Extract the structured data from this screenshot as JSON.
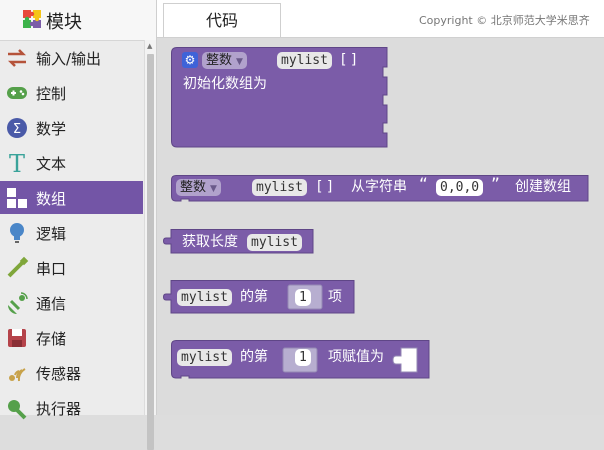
{
  "sidebar": {
    "title": "模块",
    "items": [
      {
        "label": "输入/输出",
        "icon": "arrows-icon"
      },
      {
        "label": "控制",
        "icon": "gamepad-icon"
      },
      {
        "label": "数学",
        "icon": "math-icon"
      },
      {
        "label": "文本",
        "icon": "text-icon"
      },
      {
        "label": "数组",
        "icon": "array-icon",
        "selected": true
      },
      {
        "label": "逻辑",
        "icon": "lightbulb-icon"
      },
      {
        "label": "串口",
        "icon": "serial-icon"
      },
      {
        "label": "通信",
        "icon": "satellite-icon"
      },
      {
        "label": "存储",
        "icon": "storage-icon"
      },
      {
        "label": "传感器",
        "icon": "sensor-icon"
      },
      {
        "label": "执行器",
        "icon": "actuator-icon"
      }
    ]
  },
  "tabs": {
    "code": "代码"
  },
  "copyright": "Copyright © 北京师范大学米思齐",
  "blocks": {
    "b1": {
      "type_label": "整数",
      "var": "mylist",
      "brackets": "[ ]",
      "text": "初始化数组为"
    },
    "b2": {
      "type_label": "整数",
      "var": "mylist",
      "brackets": "[ ]",
      "from_text": "从字符串",
      "quote_open": "“",
      "value": "0,0,0",
      "quote_close": "”",
      "create_text": "创建数组"
    },
    "b3": {
      "text": "获取长度",
      "var": "mylist"
    },
    "b4": {
      "var": "mylist",
      "of_text": "的第",
      "index": "1",
      "item_text": "项"
    },
    "b5": {
      "var": "mylist",
      "of_text": "的第",
      "index": "1",
      "assign_text": "项赋值为"
    }
  },
  "colors": {
    "block": "#7b5ca8",
    "selected_category": "#7355a6",
    "gear": "#3f63d8"
  }
}
